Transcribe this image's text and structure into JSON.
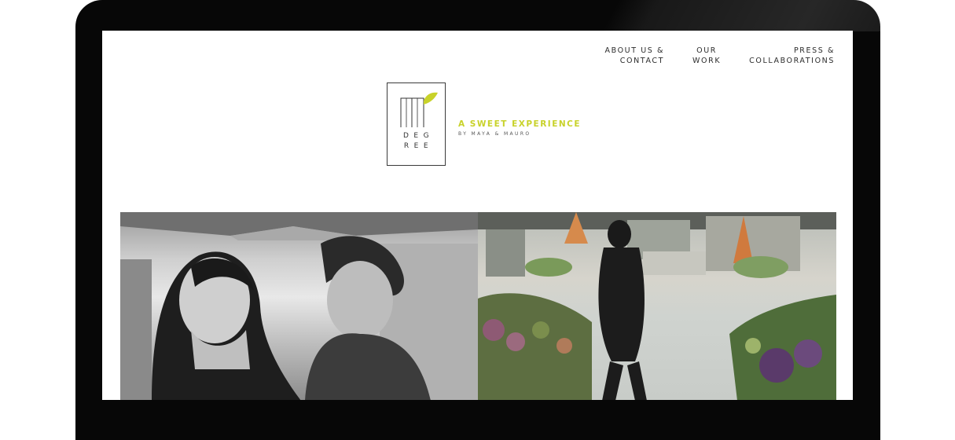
{
  "nav": {
    "items": [
      {
        "line1": "ABOUT US &",
        "line2": "CONTACT"
      },
      {
        "line1": "OUR",
        "line2": "WORK"
      },
      {
        "line1": "PRESS &",
        "line2": "COLLABORATIONS"
      }
    ]
  },
  "logo": {
    "row1": "DEG",
    "row2": "REE",
    "accent_color": "#c8d22a"
  },
  "tagline": {
    "main": "A SWEET EXPERIENCE",
    "sub": "BY MAYA & MAURO"
  },
  "photos": {
    "left_icon": "couple-photo",
    "right_icon": "market-photo"
  }
}
